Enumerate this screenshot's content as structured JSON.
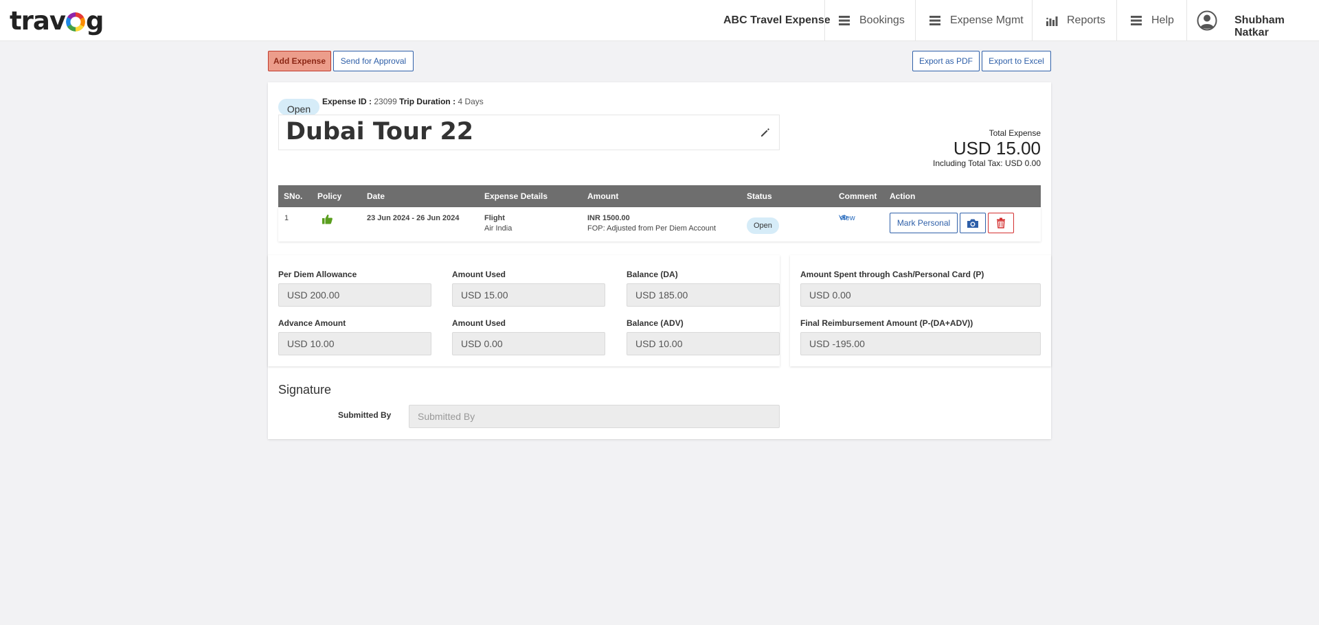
{
  "brand": {
    "logo_left": "trav",
    "logo_right": "g"
  },
  "header": {
    "company": "ABC Travel Expense",
    "nav": [
      {
        "label": "Bookings",
        "icon": "menu-icon"
      },
      {
        "label": "Expense Mgmt",
        "icon": "menu-icon"
      },
      {
        "label": "Reports",
        "icon": "bar-chart-icon"
      },
      {
        "label": "Help",
        "icon": "menu-icon"
      }
    ],
    "user_name": "Shubham Natkar"
  },
  "actions": {
    "add_expense": "Add Expense",
    "send_approval": "Send for Approval",
    "export_pdf": "Export as PDF",
    "export_excel": "Export to Excel"
  },
  "expense": {
    "status": "Open",
    "id_label": "Expense ID :",
    "id_value": "23099",
    "duration_label": "Trip Duration :",
    "duration_value": "4 Days",
    "title": "Dubai Tour 22",
    "total_label": "Total Expense",
    "total_amount": "USD 15.00",
    "tax_line": "Including Total Tax: USD 0.00"
  },
  "table": {
    "headers": [
      "SNo.",
      "Policy",
      "Date",
      "Expense Details",
      "Amount",
      "Status",
      "Comment",
      "Action"
    ],
    "rows": [
      {
        "sno": "1",
        "date": "23 Jun 2024 - 26 Jun 2024",
        "detail_type": "Flight",
        "detail_sub": "Air India",
        "amount": "INR 1500.00",
        "amount_note": "FOP: Adjusted from Per Diem Account",
        "status": "Open",
        "comment": "View",
        "mark_personal": "Mark Personal"
      }
    ]
  },
  "allowance": {
    "per_diem_label": "Per Diem Allowance",
    "per_diem_value": "USD 200.00",
    "used_da_label": "Amount Used",
    "used_da_value": "USD 15.00",
    "balance_da_label": "Balance (DA)",
    "balance_da_value": "USD 185.00",
    "advance_label": "Advance Amount",
    "advance_value": "USD 10.00",
    "used_adv_label": "Amount Used",
    "used_adv_value": "USD 0.00",
    "balance_adv_label": "Balance (ADV)",
    "balance_adv_value": "USD 10.00",
    "cash_label": "Amount Spent through Cash/Personal Card (P)",
    "cash_value": "USD 0.00",
    "final_label": "Final Reimbursement Amount (P-(DA+ADV))",
    "final_value": "USD -195.00"
  },
  "signature": {
    "title": "Signature",
    "submitted_label": "Submitted By",
    "submitted_placeholder": "Submitted By"
  },
  "colors": {
    "accent": "#2e5fa8",
    "danger": "#d32f2f",
    "table_header": "#6e6e6e",
    "policy_ok": "#5a9e1e",
    "add_button": "#ec9d8b"
  }
}
